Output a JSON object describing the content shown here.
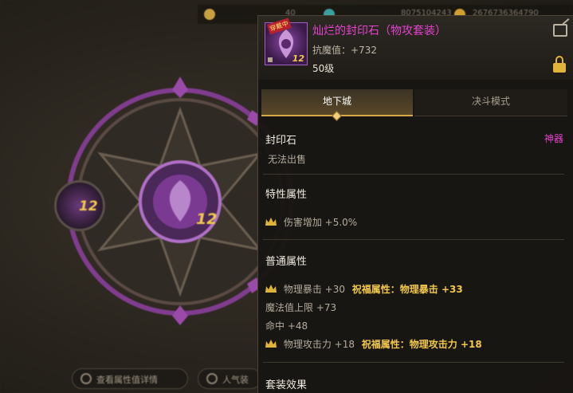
{
  "background": {
    "top_bar": {
      "currencies": [
        {
          "icon": "coin-icon",
          "text": "40",
          "color": "#c8a040"
        },
        {
          "icon": "crystal-icon",
          "text": "8075104243",
          "color": "#3aa0a0"
        },
        {
          "icon": "gold-icon",
          "text": "2676736364790",
          "color": "#d0a030"
        }
      ]
    },
    "wheel": {
      "left_slot_level": "12",
      "center_level": "12"
    },
    "bottom_buttons": [
      {
        "label": "查看属性值详情",
        "icon": "circle-icon"
      },
      {
        "label": "人气装",
        "icon": "popularity-icon"
      }
    ]
  },
  "tooltip": {
    "item": {
      "name": "灿烂的封印石（物攻套装）",
      "name_color": "#e642d0",
      "equipped_tag": "穿戴中",
      "icon_level": "12",
      "stat_line": "抗魔值：+732",
      "level_line": "50级"
    },
    "tabs": [
      {
        "label": "地下城",
        "active": true
      },
      {
        "label": "决斗模式",
        "active": false
      }
    ],
    "sections": {
      "type": {
        "title": "封印石",
        "rarity": "神器",
        "trade": "无法出售"
      },
      "special": {
        "title": "特性属性",
        "rows": [
          {
            "base": "伤害增加 +5.0%",
            "crown": true
          }
        ]
      },
      "normal": {
        "title": "普通属性",
        "rows": [
          {
            "base": "物理暴击 +30",
            "bless": "祝福属性：物理暴击 +33",
            "crown": true
          },
          {
            "base": "魔法值上限 +73",
            "bless": "",
            "crown": false
          },
          {
            "base": "命中 +48",
            "bless": "",
            "crown": false
          },
          {
            "base": "物理攻击力 +18",
            "bless": "祝福属性：物理攻击力 +18",
            "crown": true
          }
        ]
      },
      "set": {
        "title": "套装效果"
      }
    },
    "colors": {
      "bless": "#f2c84a",
      "rarity": "#e642d0",
      "accent": "#d7a848"
    }
  }
}
